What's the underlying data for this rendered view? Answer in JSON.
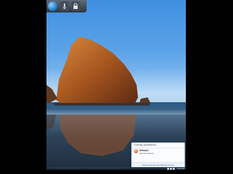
{
  "gadgets": {
    "items": [
      {
        "icon": "globe-icon"
      },
      {
        "icon": "meter-icon"
      },
      {
        "icon": "lock-icon"
      }
    ]
  },
  "network_popup": {
    "header": "Currently connected to:",
    "network_name": "Network",
    "network_status": "Internet access",
    "footer_link": "Open Network and Sharing Center"
  },
  "taskbar": {
    "clock": "4:26 PM",
    "tray_icons": [
      "up-arrow-icon",
      "network-icon",
      "volume-icon"
    ]
  },
  "colors": {
    "sky": "#5ba3e8",
    "rock": "#b3642a",
    "sea": "#2a5a86",
    "popup_border": "#8da2bb",
    "link": "#1b63b5"
  }
}
